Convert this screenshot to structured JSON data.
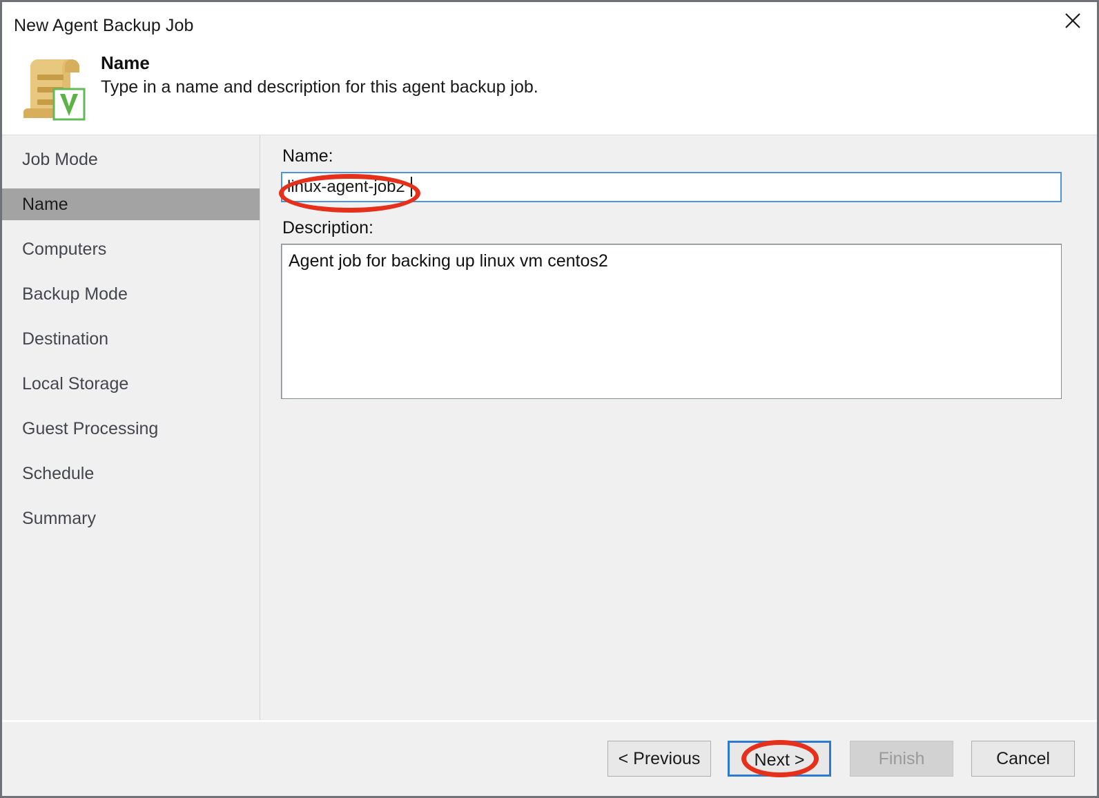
{
  "window": {
    "title": "New Agent Backup Job",
    "close_icon": "close-icon"
  },
  "header": {
    "icon": "document-scroll-veeam-icon",
    "title": "Name",
    "subtitle": "Type in a name and description for this agent backup job."
  },
  "sidebar": {
    "items": [
      {
        "label": "Job Mode",
        "active": false
      },
      {
        "label": "Name",
        "active": true
      },
      {
        "label": "Computers",
        "active": false
      },
      {
        "label": "Backup Mode",
        "active": false
      },
      {
        "label": "Destination",
        "active": false
      },
      {
        "label": "Local Storage",
        "active": false
      },
      {
        "label": "Guest Processing",
        "active": false
      },
      {
        "label": "Schedule",
        "active": false
      },
      {
        "label": "Summary",
        "active": false
      }
    ]
  },
  "form": {
    "name_label": "Name:",
    "name_value": "linux-agent-job2",
    "name_placeholder": "",
    "description_label": "Description:",
    "description_value": "Agent job for backing up linux vm centos2",
    "description_placeholder": ""
  },
  "footer": {
    "previous_label": "< Previous",
    "next_label": "Next >",
    "finish_label": "Finish",
    "cancel_label": "Cancel"
  },
  "annotations": {
    "color": "#e5301b",
    "targets": [
      "name-input",
      "next-button"
    ]
  },
  "colors": {
    "window_border": "#6e7277",
    "body_background": "#f0f0f0",
    "sidebar_active": "#a3a3a3",
    "focus_blue": "#2a7ad4",
    "input_focus_border": "#4c93d9",
    "disabled_text": "#9a9a9a",
    "annotation_red": "#e5301b"
  }
}
